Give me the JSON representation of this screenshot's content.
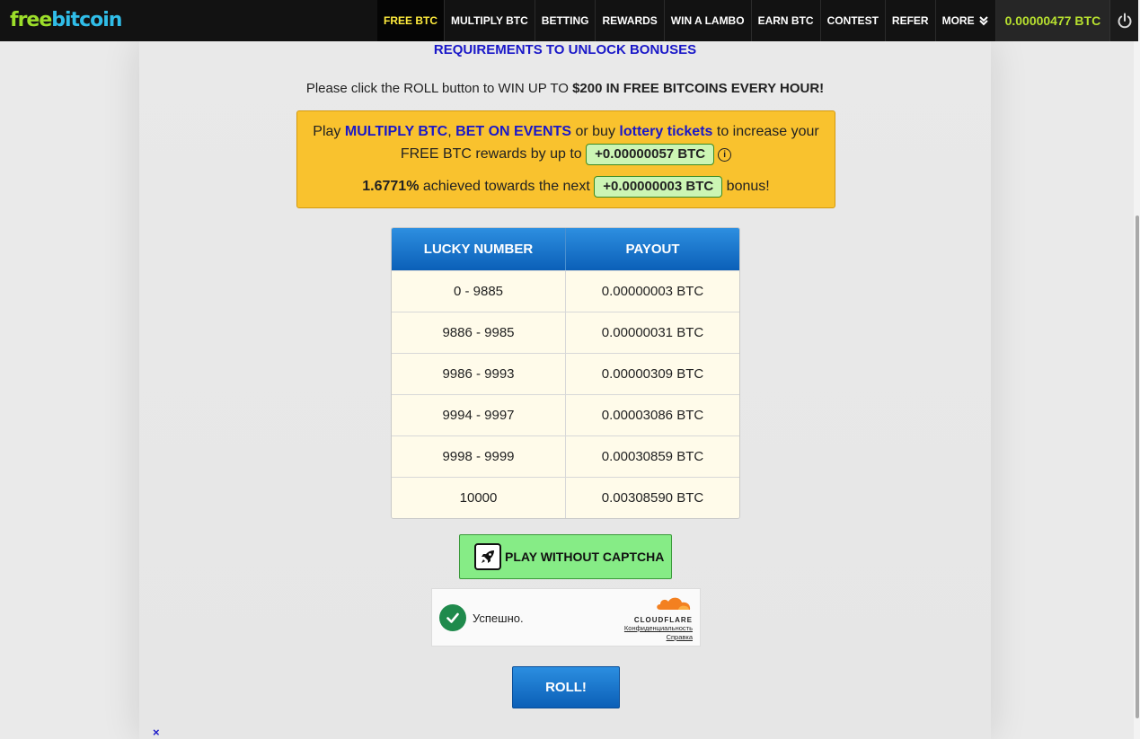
{
  "logo": {
    "part1": "free",
    "part2": "bitcoin"
  },
  "nav": {
    "items": [
      {
        "label": "FREE BTC"
      },
      {
        "label": "MULTIPLY BTC"
      },
      {
        "label": "BETTING"
      },
      {
        "label": "REWARDS"
      },
      {
        "label": "WIN A LAMBO"
      },
      {
        "label": "EARN BTC"
      },
      {
        "label": "CONTEST"
      },
      {
        "label": "REFER"
      },
      {
        "label": "MORE"
      }
    ],
    "balance": "0.00000477 BTC"
  },
  "requirements_link": "REQUIREMENTS TO UNLOCK BONUSES",
  "intro": {
    "text": "Please click the ROLL button to WIN UP TO ",
    "bold": "$200 IN FREE BITCOINS EVERY HOUR!"
  },
  "bonus": {
    "play": "Play ",
    "multiply": "MULTIPLY BTC",
    "comma": ", ",
    "bet": "BET ON EVENTS",
    "or_buy": " or buy ",
    "lottery": "lottery tickets",
    "increase": " to increase your",
    "line2": "FREE BTC rewards by up to ",
    "max_bonus": "+0.00000057 BTC",
    "info_glyph": "i",
    "percent": "1.6771%",
    "achieved": " achieved towards the next ",
    "next_bonus": "+0.00000003 BTC",
    "bonus_word": " bonus!"
  },
  "payout_table": {
    "headers": [
      "LUCKY NUMBER",
      "PAYOUT"
    ],
    "rows": [
      [
        "0 - 9885",
        "0.00000003 BTC"
      ],
      [
        "9886 - 9985",
        "0.00000031 BTC"
      ],
      [
        "9986 - 9993",
        "0.00000309 BTC"
      ],
      [
        "9994 - 9997",
        "0.00003086 BTC"
      ],
      [
        "9998 - 9999",
        "0.00030859 BTC"
      ],
      [
        "10000",
        "0.00308590 BTC"
      ]
    ]
  },
  "captcha_button": "PLAY WITHOUT CAPTCHA",
  "cloudflare": {
    "status": "Успешно.",
    "brand": "CLOUDFLARE",
    "privacy": "Конфиденциальность",
    "help": "Справка"
  },
  "roll_button": "ROLL!",
  "close_glyph": "×",
  "colors": {
    "topbar": "#121212",
    "active_nav": "#ffec3d",
    "balance": "#b7e02f",
    "bonus_box": "#f9c22e",
    "link_blue": "#1a18c8",
    "table_head": "#0b60b8",
    "captcha_green": "#86ec86",
    "cloudflare_orange": "#f38020"
  }
}
